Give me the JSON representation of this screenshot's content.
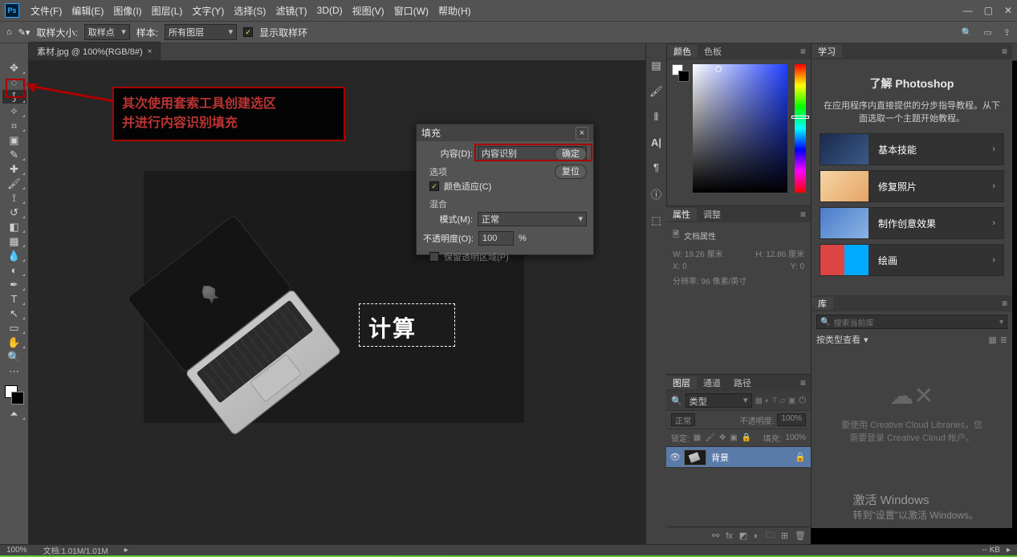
{
  "menu": {
    "items": [
      "文件(F)",
      "编辑(E)",
      "图像(I)",
      "图层(L)",
      "文字(Y)",
      "选择(S)",
      "滤镜(T)",
      "3D(D)",
      "视图(V)",
      "窗口(W)",
      "帮助(H)"
    ]
  },
  "optbar": {
    "sample_size_label": "取样大小:",
    "sample_size_value": "取样点",
    "sample_label": "样本:",
    "sample_value": "所有图层",
    "show_ring": "显示取样环"
  },
  "doc": {
    "tab": "素材.jpg @ 100%(RGB/8#)"
  },
  "annotation": {
    "line1": "其次使用套索工具创建选区",
    "line2": "并进行内容识别填充"
  },
  "canvas": {
    "selection_text": "计算"
  },
  "fill_dialog": {
    "title": "填充",
    "content_label": "内容(D):",
    "content_value": "内容识别",
    "ok": "确定",
    "reset": "复位",
    "options": "选项",
    "color_adapt": "颜色适应(C)",
    "blend": "混合",
    "mode_label": "模式(M):",
    "mode_value": "正常",
    "opacity_label": "不透明度(O):",
    "opacity_value": "100",
    "opacity_unit": "%",
    "preserve": "保留透明区域(P)"
  },
  "color_panel": {
    "tabs": [
      "颜色",
      "色板"
    ]
  },
  "props_panel": {
    "tabs": [
      "属性",
      "调整"
    ],
    "header": "文档属性",
    "w_label": "W:",
    "w_val": "19.26 厘米",
    "h_label": "H:",
    "h_val": "12.86 厘米",
    "x_label": "X:",
    "x_val": "0",
    "y_label": "Y:",
    "y_val": "0",
    "res": "分辨率: 96 像素/英寸"
  },
  "layers_panel": {
    "tabs": [
      "图层",
      "通道",
      "路径"
    ],
    "kind": "类型",
    "blend": "正常",
    "opacity_label": "不透明度:",
    "opacity_value": "100%",
    "lock_label": "锁定:",
    "fill_label": "填充:",
    "fill_value": "100%",
    "layer_name": "背景"
  },
  "learn_panel": {
    "tab": "学习",
    "title": "了解 Photoshop",
    "desc": "在应用程序内直接提供的分步指导教程。从下面选取一个主题开始教程。",
    "items": [
      "基本技能",
      "修复照片",
      "制作创意效果",
      "绘画"
    ]
  },
  "libs_panel": {
    "tab": "库",
    "search_placeholder": "搜索当前库",
    "filter": "按类型查看",
    "empty1": "要使用 Creative Cloud Libraries，您",
    "empty2": "需要登录 Creative Cloud 帐户。"
  },
  "watermark": {
    "line1": "激活 Windows",
    "line2": "转到\"设置\"以激活 Windows。"
  },
  "status": {
    "zoom": "100%",
    "docsize": "文档:1.01M/1.01M",
    "mb": "-- KB"
  }
}
